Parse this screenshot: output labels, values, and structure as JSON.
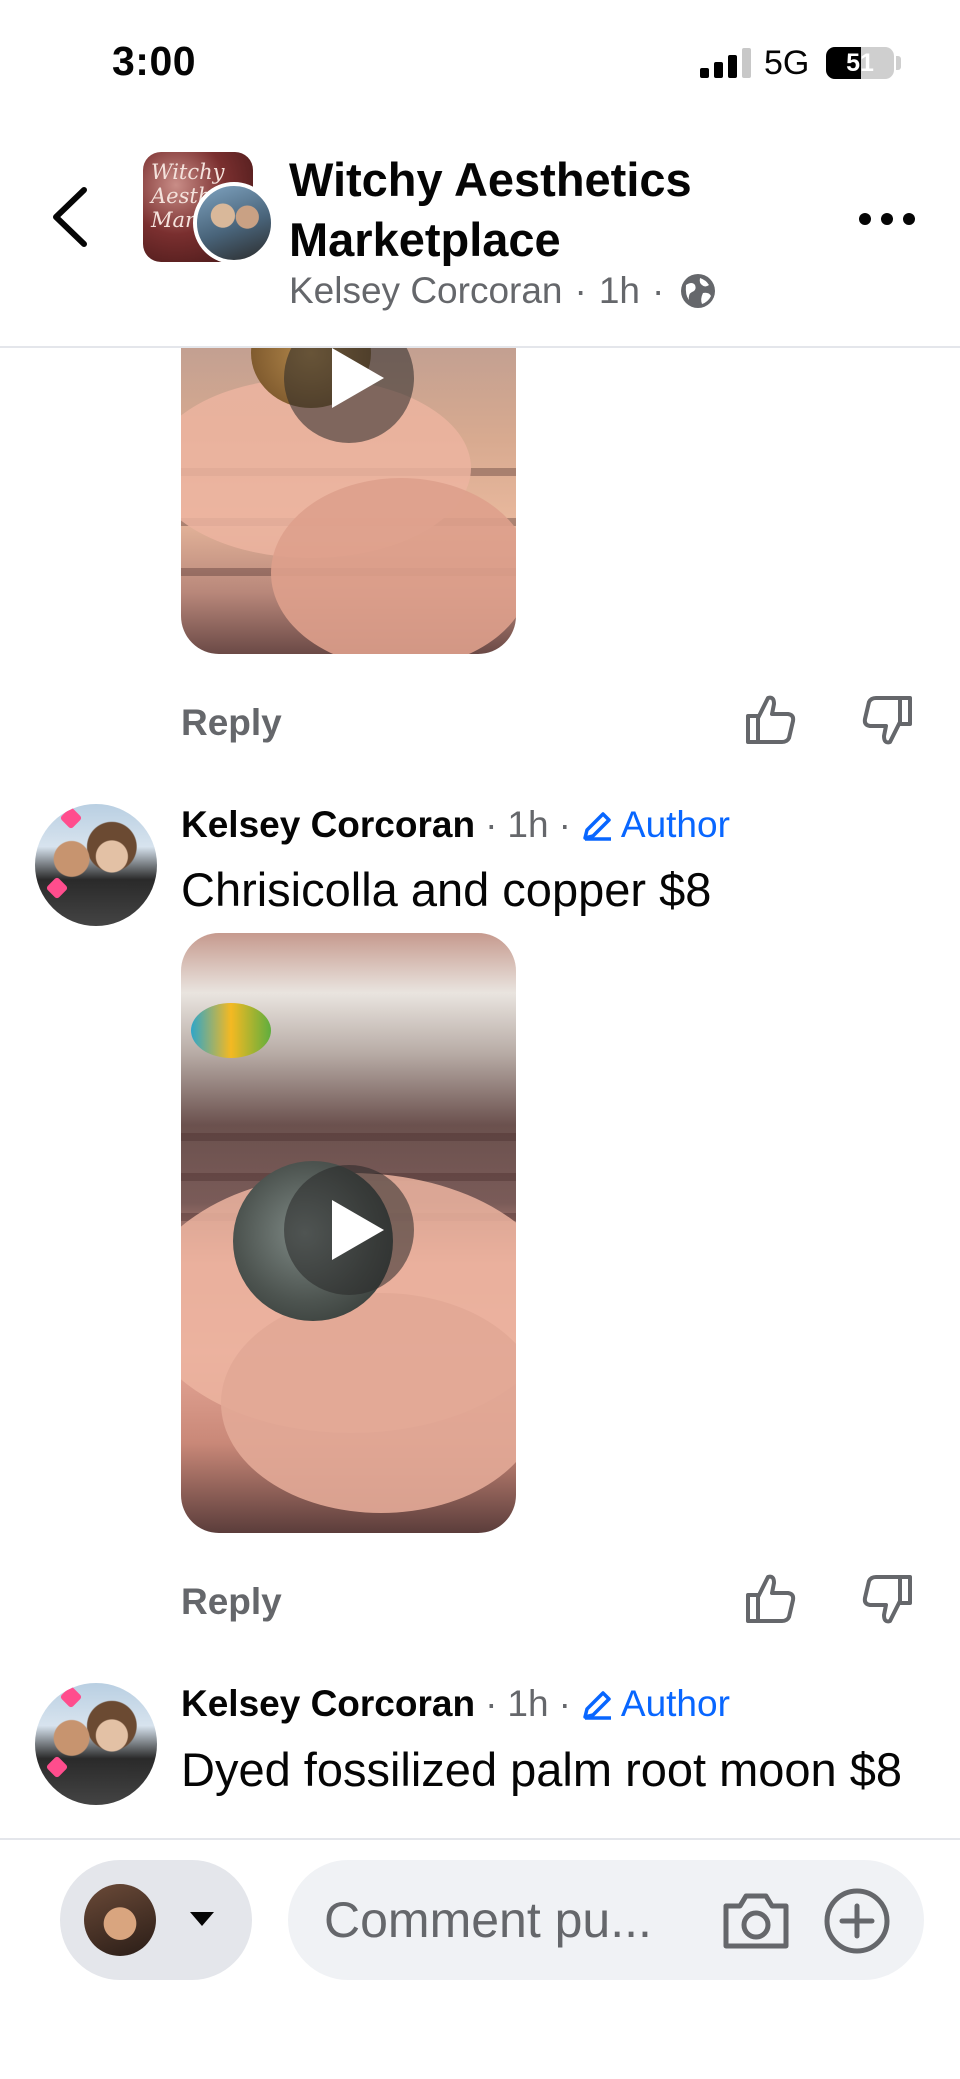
{
  "status_bar": {
    "time": "3:00",
    "network": "5G",
    "battery_level": "51",
    "battery_fraction": 0.51,
    "signal_bars_active": 3,
    "signal_bars_total": 4
  },
  "header": {
    "group_name": "Witchy Aesthetics Marketplace",
    "poster_name": "Kelsey Corcoran",
    "time_ago": "1h",
    "audience_icon": "globe-icon",
    "avatar_text": "Witchy Aesthetics Market"
  },
  "thread": {
    "reply_label": "Reply",
    "comments": [
      {
        "author": "Kelsey Corcoran",
        "time": "1h",
        "badge": "Author",
        "text": "Chrisicolla and copper $8"
      },
      {
        "author": "Kelsey Corcoran",
        "time": "1h",
        "badge": "Author",
        "text": "Dyed fossilized palm root moon $8"
      }
    ]
  },
  "composer": {
    "placeholder": "Comment pu..."
  },
  "colors": {
    "accent": "#0866ff",
    "secondary_text": "#65676b",
    "primary_text": "#050505"
  }
}
